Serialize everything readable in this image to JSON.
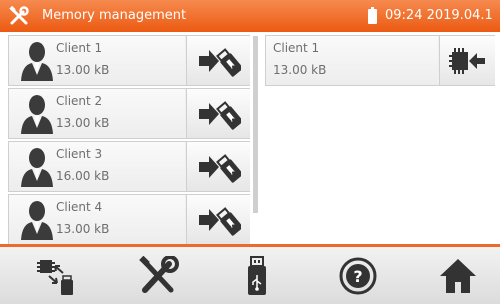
{
  "header": {
    "title": "Memory management",
    "clock": "09:24 2019.04.1",
    "accent_color": "#ee6a2a",
    "app_icon": "tools-icon",
    "battery_icon": "battery-icon"
  },
  "left_list": {
    "items": [
      {
        "name": "Client 1",
        "size": "13.00 kB",
        "action_icon": "export-to-usb-icon"
      },
      {
        "name": "Client 2",
        "size": "13.00 kB",
        "action_icon": "export-to-usb-icon"
      },
      {
        "name": "Client 3",
        "size": "16.00 kB",
        "action_icon": "export-to-usb-icon"
      },
      {
        "name": "Client 4",
        "size": "13.00 kB",
        "action_icon": "export-to-usb-icon"
      }
    ]
  },
  "right_panel": {
    "item": {
      "name": "Client 1",
      "size": "13.00 kB",
      "action_icon": "import-to-memory-icon"
    }
  },
  "toolbar": {
    "buttons": [
      {
        "icon": "memory-usb-transfer-icon"
      },
      {
        "icon": "settings-tools-icon"
      },
      {
        "icon": "usb-stick-icon"
      },
      {
        "icon": "help-icon"
      },
      {
        "icon": "home-icon"
      }
    ]
  }
}
